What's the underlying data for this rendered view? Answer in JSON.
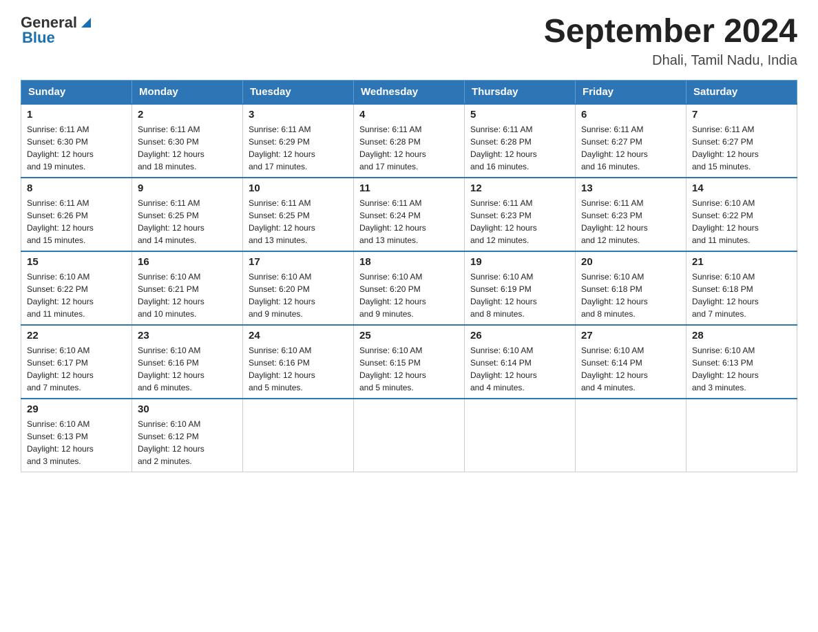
{
  "header": {
    "logo_general": "General",
    "logo_blue": "Blue",
    "title": "September 2024",
    "subtitle": "Dhali, Tamil Nadu, India"
  },
  "days_of_week": [
    "Sunday",
    "Monday",
    "Tuesday",
    "Wednesday",
    "Thursday",
    "Friday",
    "Saturday"
  ],
  "weeks": [
    [
      {
        "day": "1",
        "sunrise": "6:11 AM",
        "sunset": "6:30 PM",
        "daylight": "12 hours and 19 minutes."
      },
      {
        "day": "2",
        "sunrise": "6:11 AM",
        "sunset": "6:30 PM",
        "daylight": "12 hours and 18 minutes."
      },
      {
        "day": "3",
        "sunrise": "6:11 AM",
        "sunset": "6:29 PM",
        "daylight": "12 hours and 17 minutes."
      },
      {
        "day": "4",
        "sunrise": "6:11 AM",
        "sunset": "6:28 PM",
        "daylight": "12 hours and 17 minutes."
      },
      {
        "day": "5",
        "sunrise": "6:11 AM",
        "sunset": "6:28 PM",
        "daylight": "12 hours and 16 minutes."
      },
      {
        "day": "6",
        "sunrise": "6:11 AM",
        "sunset": "6:27 PM",
        "daylight": "12 hours and 16 minutes."
      },
      {
        "day": "7",
        "sunrise": "6:11 AM",
        "sunset": "6:27 PM",
        "daylight": "12 hours and 15 minutes."
      }
    ],
    [
      {
        "day": "8",
        "sunrise": "6:11 AM",
        "sunset": "6:26 PM",
        "daylight": "12 hours and 15 minutes."
      },
      {
        "day": "9",
        "sunrise": "6:11 AM",
        "sunset": "6:25 PM",
        "daylight": "12 hours and 14 minutes."
      },
      {
        "day": "10",
        "sunrise": "6:11 AM",
        "sunset": "6:25 PM",
        "daylight": "12 hours and 13 minutes."
      },
      {
        "day": "11",
        "sunrise": "6:11 AM",
        "sunset": "6:24 PM",
        "daylight": "12 hours and 13 minutes."
      },
      {
        "day": "12",
        "sunrise": "6:11 AM",
        "sunset": "6:23 PM",
        "daylight": "12 hours and 12 minutes."
      },
      {
        "day": "13",
        "sunrise": "6:11 AM",
        "sunset": "6:23 PM",
        "daylight": "12 hours and 12 minutes."
      },
      {
        "day": "14",
        "sunrise": "6:10 AM",
        "sunset": "6:22 PM",
        "daylight": "12 hours and 11 minutes."
      }
    ],
    [
      {
        "day": "15",
        "sunrise": "6:10 AM",
        "sunset": "6:22 PM",
        "daylight": "12 hours and 11 minutes."
      },
      {
        "day": "16",
        "sunrise": "6:10 AM",
        "sunset": "6:21 PM",
        "daylight": "12 hours and 10 minutes."
      },
      {
        "day": "17",
        "sunrise": "6:10 AM",
        "sunset": "6:20 PM",
        "daylight": "12 hours and 9 minutes."
      },
      {
        "day": "18",
        "sunrise": "6:10 AM",
        "sunset": "6:20 PM",
        "daylight": "12 hours and 9 minutes."
      },
      {
        "day": "19",
        "sunrise": "6:10 AM",
        "sunset": "6:19 PM",
        "daylight": "12 hours and 8 minutes."
      },
      {
        "day": "20",
        "sunrise": "6:10 AM",
        "sunset": "6:18 PM",
        "daylight": "12 hours and 8 minutes."
      },
      {
        "day": "21",
        "sunrise": "6:10 AM",
        "sunset": "6:18 PM",
        "daylight": "12 hours and 7 minutes."
      }
    ],
    [
      {
        "day": "22",
        "sunrise": "6:10 AM",
        "sunset": "6:17 PM",
        "daylight": "12 hours and 7 minutes."
      },
      {
        "day": "23",
        "sunrise": "6:10 AM",
        "sunset": "6:16 PM",
        "daylight": "12 hours and 6 minutes."
      },
      {
        "day": "24",
        "sunrise": "6:10 AM",
        "sunset": "6:16 PM",
        "daylight": "12 hours and 5 minutes."
      },
      {
        "day": "25",
        "sunrise": "6:10 AM",
        "sunset": "6:15 PM",
        "daylight": "12 hours and 5 minutes."
      },
      {
        "day": "26",
        "sunrise": "6:10 AM",
        "sunset": "6:14 PM",
        "daylight": "12 hours and 4 minutes."
      },
      {
        "day": "27",
        "sunrise": "6:10 AM",
        "sunset": "6:14 PM",
        "daylight": "12 hours and 4 minutes."
      },
      {
        "day": "28",
        "sunrise": "6:10 AM",
        "sunset": "6:13 PM",
        "daylight": "12 hours and 3 minutes."
      }
    ],
    [
      {
        "day": "29",
        "sunrise": "6:10 AM",
        "sunset": "6:13 PM",
        "daylight": "12 hours and 3 minutes."
      },
      {
        "day": "30",
        "sunrise": "6:10 AM",
        "sunset": "6:12 PM",
        "daylight": "12 hours and 2 minutes."
      },
      null,
      null,
      null,
      null,
      null
    ]
  ],
  "labels": {
    "sunrise": "Sunrise:",
    "sunset": "Sunset:",
    "daylight": "Daylight: 12 hours"
  }
}
